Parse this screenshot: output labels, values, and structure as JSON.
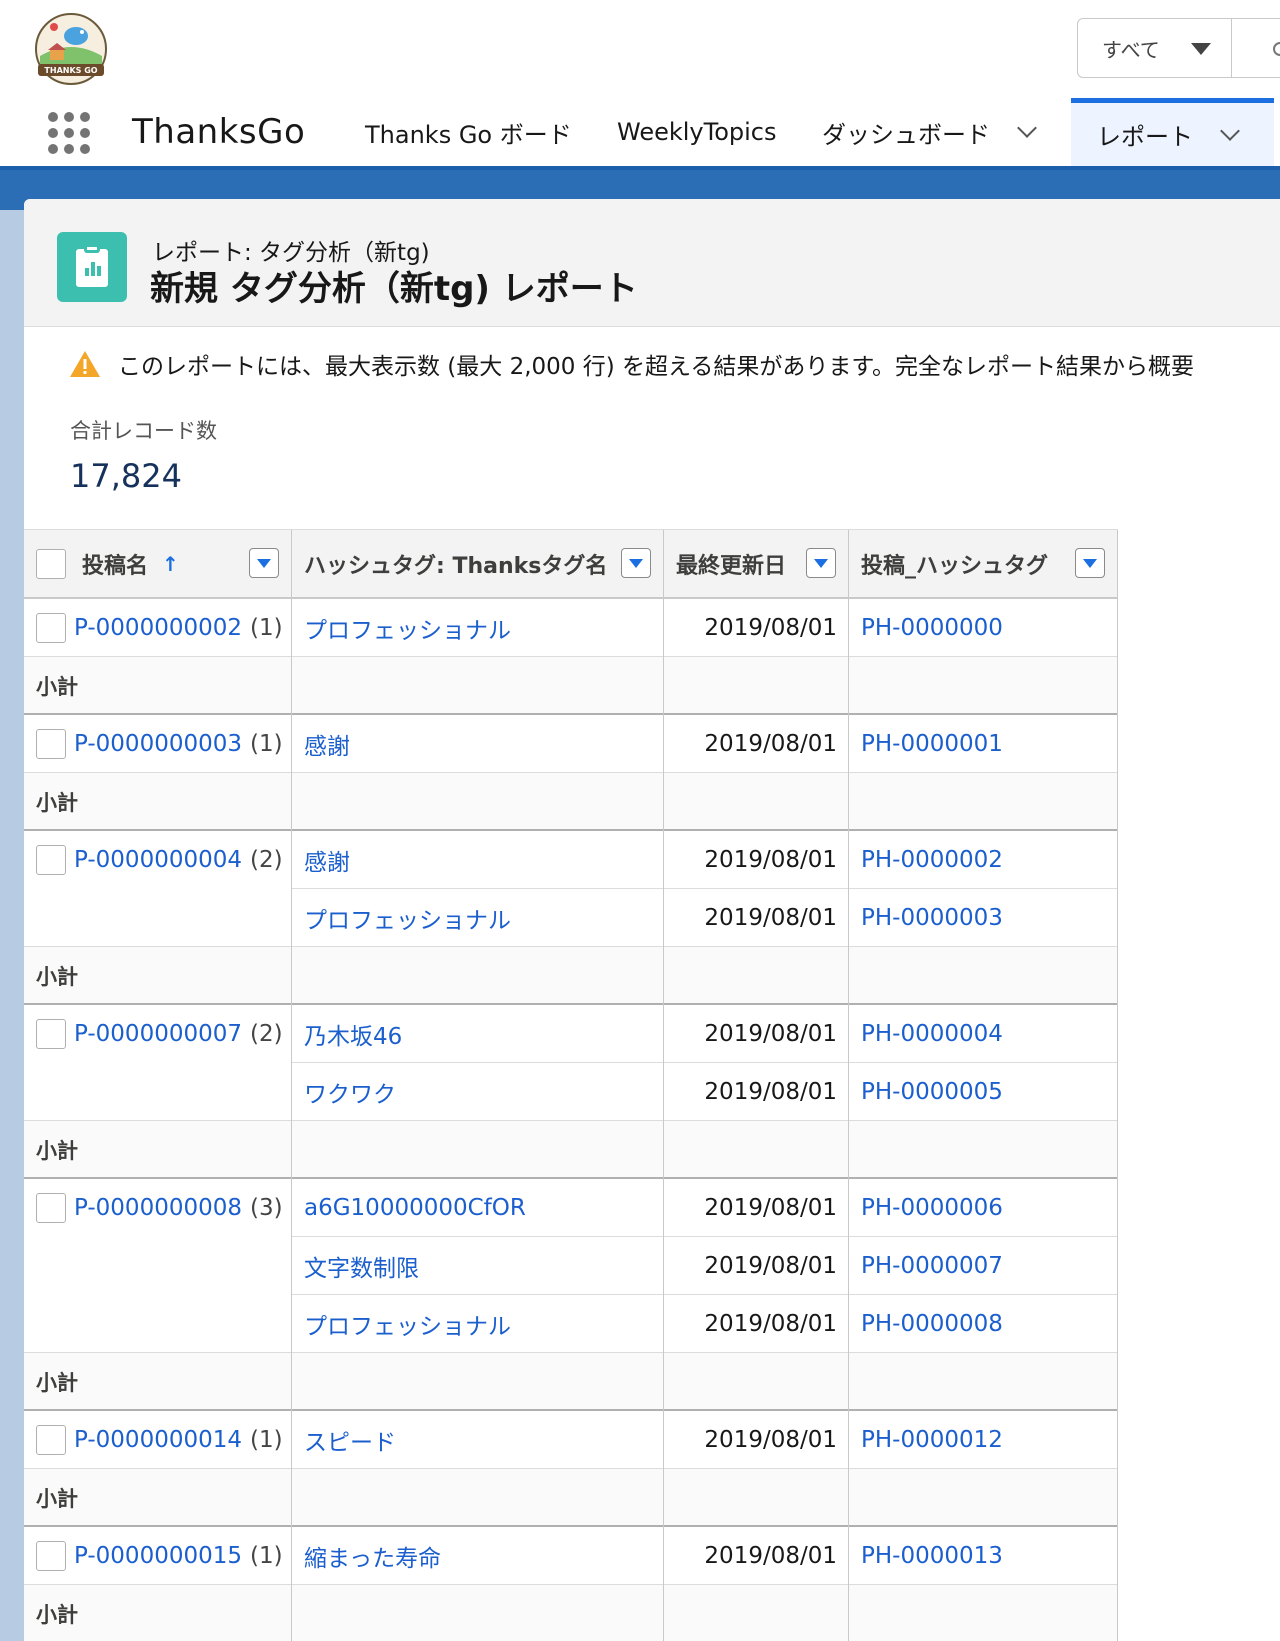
{
  "search": {
    "scope_label": "すべて"
  },
  "nav": {
    "app_name": "ThanksGo",
    "items": [
      {
        "label": "Thanks Go ボード"
      },
      {
        "label": "WeeklyTopics"
      },
      {
        "label": "ダッシュボード"
      },
      {
        "label": "レポート"
      }
    ]
  },
  "report": {
    "breadcrumb": "レポート: タグ分析（新tg)",
    "title": "新規 タグ分析（新tg) レポート",
    "warning": "このレポートには、最大表示数 (最大 2,000 行) を超える結果があります。完全なレポート結果から概要",
    "count_label": "合計レコード数",
    "count_value": "17,824"
  },
  "table": {
    "columns": [
      {
        "label": "投稿名",
        "sort": "asc"
      },
      {
        "label": "ハッシュタグ: Thanksタグ名"
      },
      {
        "label": "最終更新日"
      },
      {
        "label": "投稿_ハッシュタグ"
      }
    ],
    "subtotal_label": "小計",
    "groups": [
      {
        "post": "P-0000000002",
        "count": "(1)",
        "rows": [
          {
            "tag": "プロフェッショナル",
            "date": "2019/08/01",
            "ph": "PH-0000000"
          }
        ]
      },
      {
        "post": "P-0000000003",
        "count": "(1)",
        "rows": [
          {
            "tag": "感謝",
            "date": "2019/08/01",
            "ph": "PH-0000001"
          }
        ]
      },
      {
        "post": "P-0000000004",
        "count": "(2)",
        "rows": [
          {
            "tag": "感謝",
            "date": "2019/08/01",
            "ph": "PH-0000002"
          },
          {
            "tag": "プロフェッショナル",
            "date": "2019/08/01",
            "ph": "PH-0000003"
          }
        ]
      },
      {
        "post": "P-0000000007",
        "count": "(2)",
        "rows": [
          {
            "tag": "乃木坂46",
            "date": "2019/08/01",
            "ph": "PH-0000004"
          },
          {
            "tag": "ワクワク",
            "date": "2019/08/01",
            "ph": "PH-0000005"
          }
        ]
      },
      {
        "post": "P-0000000008",
        "count": "(3)",
        "rows": [
          {
            "tag": "a6G10000000CfOR",
            "date": "2019/08/01",
            "ph": "PH-0000006"
          },
          {
            "tag": "文字数制限",
            "date": "2019/08/01",
            "ph": "PH-0000007"
          },
          {
            "tag": "プロフェッショナル",
            "date": "2019/08/01",
            "ph": "PH-0000008"
          }
        ]
      },
      {
        "post": "P-0000000014",
        "count": "(1)",
        "rows": [
          {
            "tag": "スピード",
            "date": "2019/08/01",
            "ph": "PH-0000012"
          }
        ]
      },
      {
        "post": "P-0000000015",
        "count": "(1)",
        "rows": [
          {
            "tag": "縮まった寿命",
            "date": "2019/08/01",
            "ph": "PH-0000013"
          }
        ]
      }
    ]
  },
  "colors": {
    "link": "#1b5fce",
    "brand_blue": "#1b5fab",
    "report_icon": "#3cbfae",
    "warning": "#f4a629"
  }
}
